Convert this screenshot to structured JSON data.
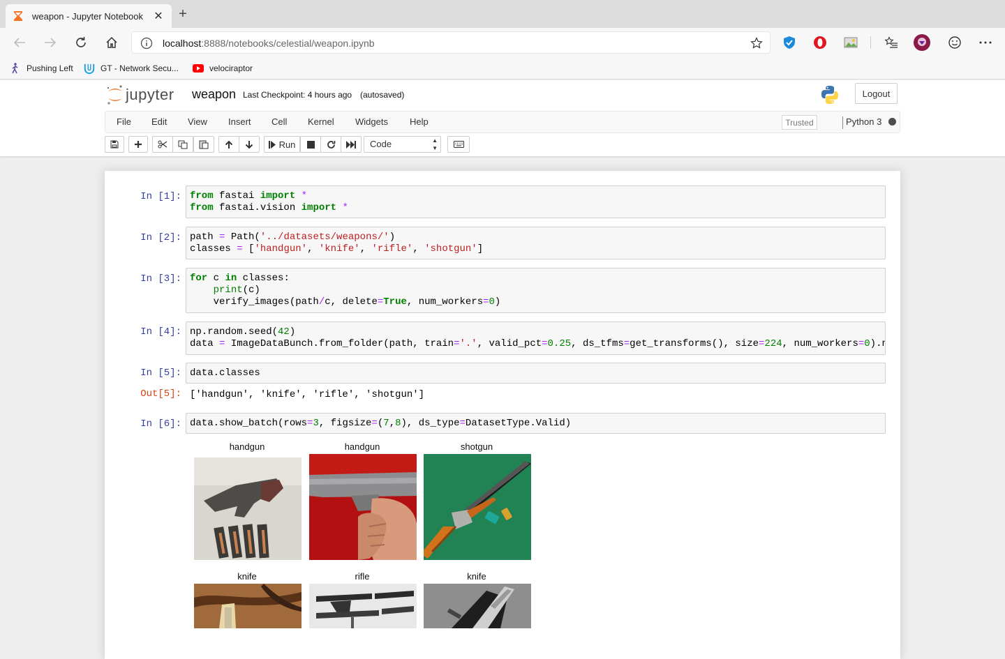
{
  "browser": {
    "tab_title": "weapon - Jupyter Notebook",
    "url_host": "localhost",
    "url_rest": ":8888/notebooks/celestial/weapon.ipynb",
    "bookmarks": [
      {
        "label": "Pushing Left"
      },
      {
        "label": "GT - Network Secu..."
      },
      {
        "label": "velociraptor"
      }
    ]
  },
  "jupyter": {
    "logo_text": "jupyter",
    "notebook_name": "weapon",
    "checkpoint": "Last Checkpoint: 4 hours ago",
    "autosave": "(autosaved)",
    "logout": "Logout",
    "menu": [
      "File",
      "Edit",
      "View",
      "Insert",
      "Cell",
      "Kernel",
      "Widgets",
      "Help"
    ],
    "trusted": "Trusted",
    "kernel": "Python 3",
    "run_label": "Run",
    "cell_type": "Code"
  },
  "cells": {
    "c1": {
      "prompt": "In [1]:"
    },
    "c2": {
      "prompt": "In [2]:"
    },
    "c3": {
      "prompt": "In [3]:"
    },
    "c4": {
      "prompt": "In [4]:"
    },
    "c5": {
      "prompt": "In [5]:",
      "out_prompt": "Out[5]:",
      "output": "['handgun', 'knife', 'rifle', 'shotgun']"
    },
    "c6": {
      "prompt": "In [6]:"
    }
  },
  "batch": {
    "labels": [
      "handgun",
      "handgun",
      "shotgun",
      "knife",
      "rifle",
      "knife"
    ]
  }
}
